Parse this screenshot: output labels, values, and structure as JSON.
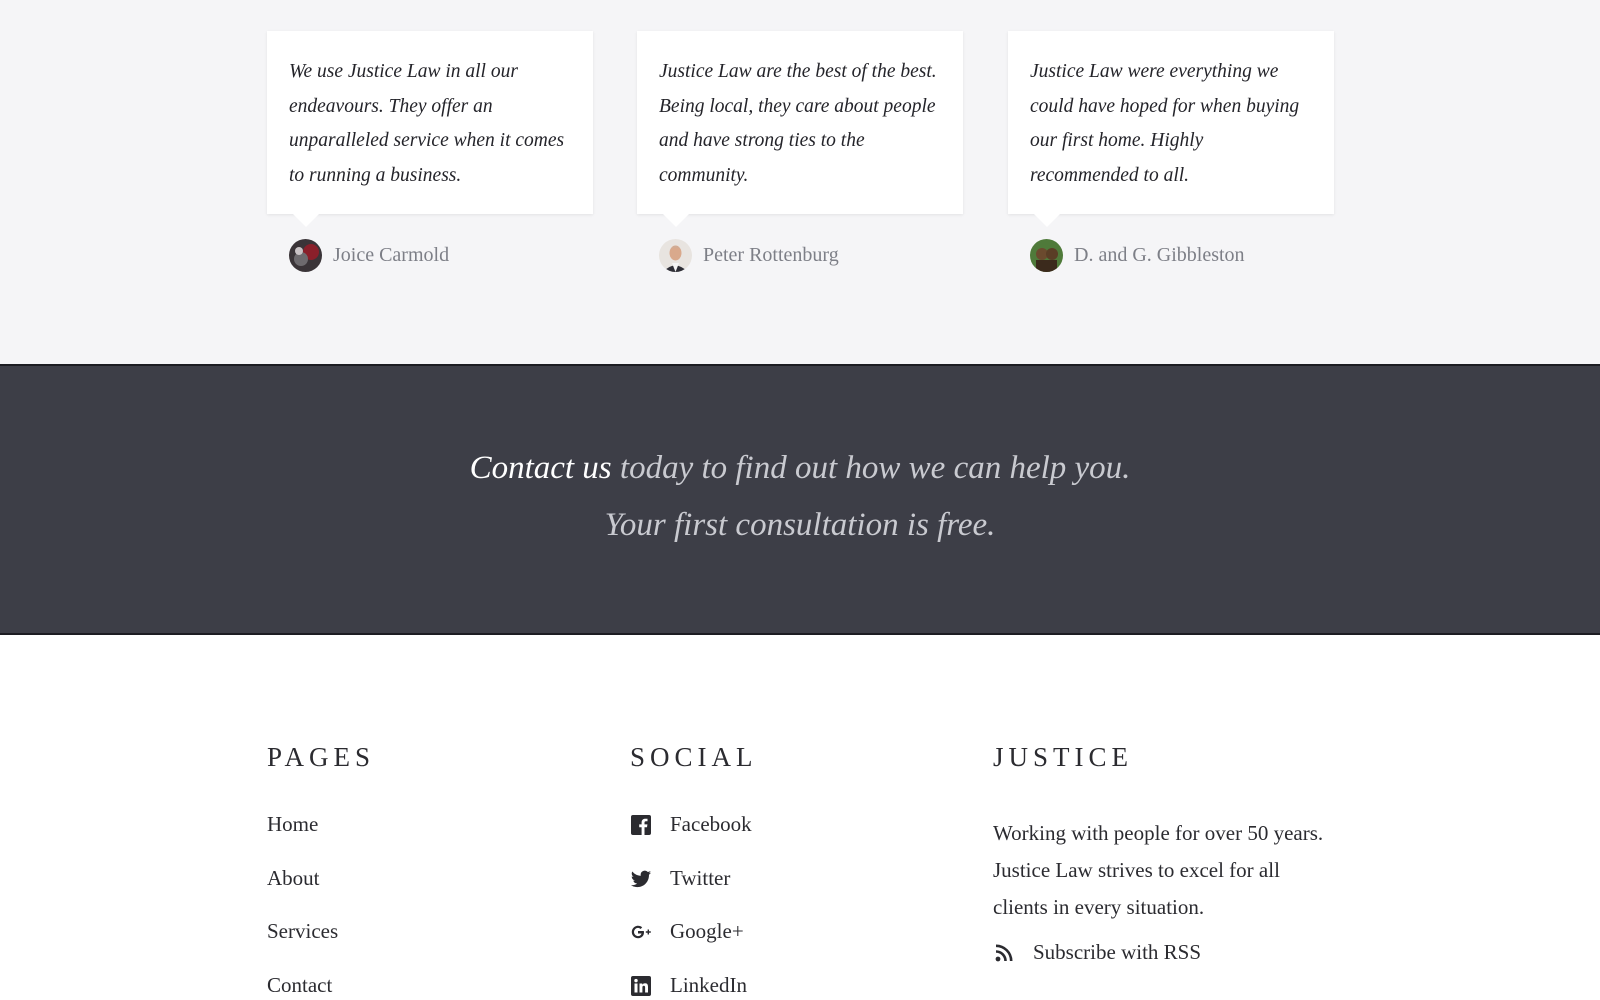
{
  "testimonials": [
    {
      "quote": "We use Justice Law in all our endeavours. They offer an unparalleled service when it comes to running a business.",
      "author": "Joice Carmold"
    },
    {
      "quote": "Justice Law are the best of the best. Being local, they care about people and have strong ties to the community.",
      "author": "Peter Rottenburg"
    },
    {
      "quote": "Justice Law were everything we could have hoped for when buying our first home. Highly recommended to all.",
      "author": "D. and G. Gibbleston"
    }
  ],
  "cta": {
    "link_text": "Contact us",
    "line1_rest": " today to find out how we can help you.",
    "line2": "Your first consultation is free."
  },
  "footer": {
    "pages": {
      "heading": "PAGES",
      "links": [
        "Home",
        "About",
        "Services",
        "Contact"
      ]
    },
    "social": {
      "heading": "SOCIAL",
      "links": [
        {
          "label": "Facebook",
          "icon": "facebook-icon"
        },
        {
          "label": "Twitter",
          "icon": "twitter-icon"
        },
        {
          "label": "Google+",
          "icon": "google-plus-icon"
        },
        {
          "label": "LinkedIn",
          "icon": "linkedin-icon"
        }
      ]
    },
    "justice": {
      "heading": "JUSTICE",
      "text": "Working with people for over 50 years. Justice Law strives to excel for all clients in every situation.",
      "rss_label": "Subscribe with RSS",
      "rss_icon": "rss-icon"
    }
  },
  "colors": {
    "testimonial_bg": "#f5f5f7",
    "cta_bg": "#3d3e47",
    "cta_text": "#c9cad0",
    "author_text": "#7d7f87",
    "body_text": "#2b2b30"
  }
}
